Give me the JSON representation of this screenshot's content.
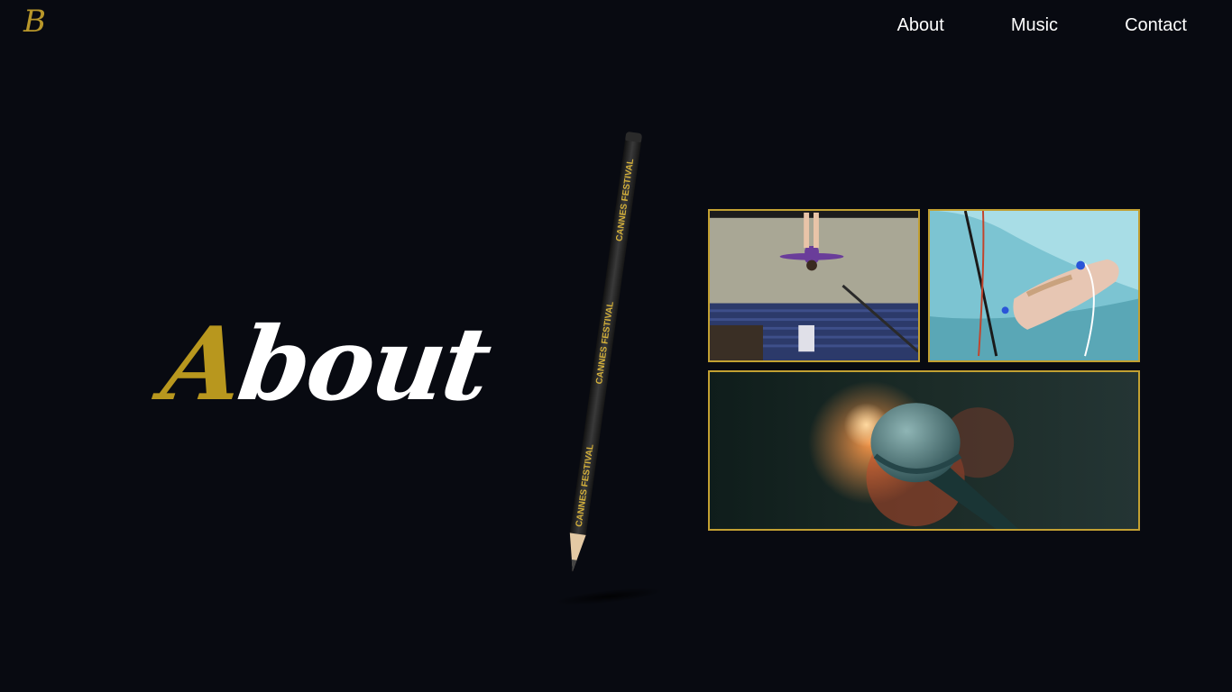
{
  "header": {
    "logo_letter": "B",
    "nav": [
      {
        "label": "About"
      },
      {
        "label": "Music"
      },
      {
        "label": "Contact"
      }
    ]
  },
  "hero": {
    "title_first_letter": "A",
    "title_rest": "bout"
  },
  "pencil": {
    "print_text": "CANNES FESTIVAL"
  },
  "colors": {
    "background": "#080a11",
    "accent_gold": "#b8971e",
    "frame_gold": "#c2a032",
    "text": "#ffffff"
  },
  "gallery": {
    "images": [
      {
        "subject": "gymnast-beam-photo"
      },
      {
        "subject": "hospital-iv-hand-photo"
      },
      {
        "subject": "microphone-photo"
      }
    ]
  }
}
